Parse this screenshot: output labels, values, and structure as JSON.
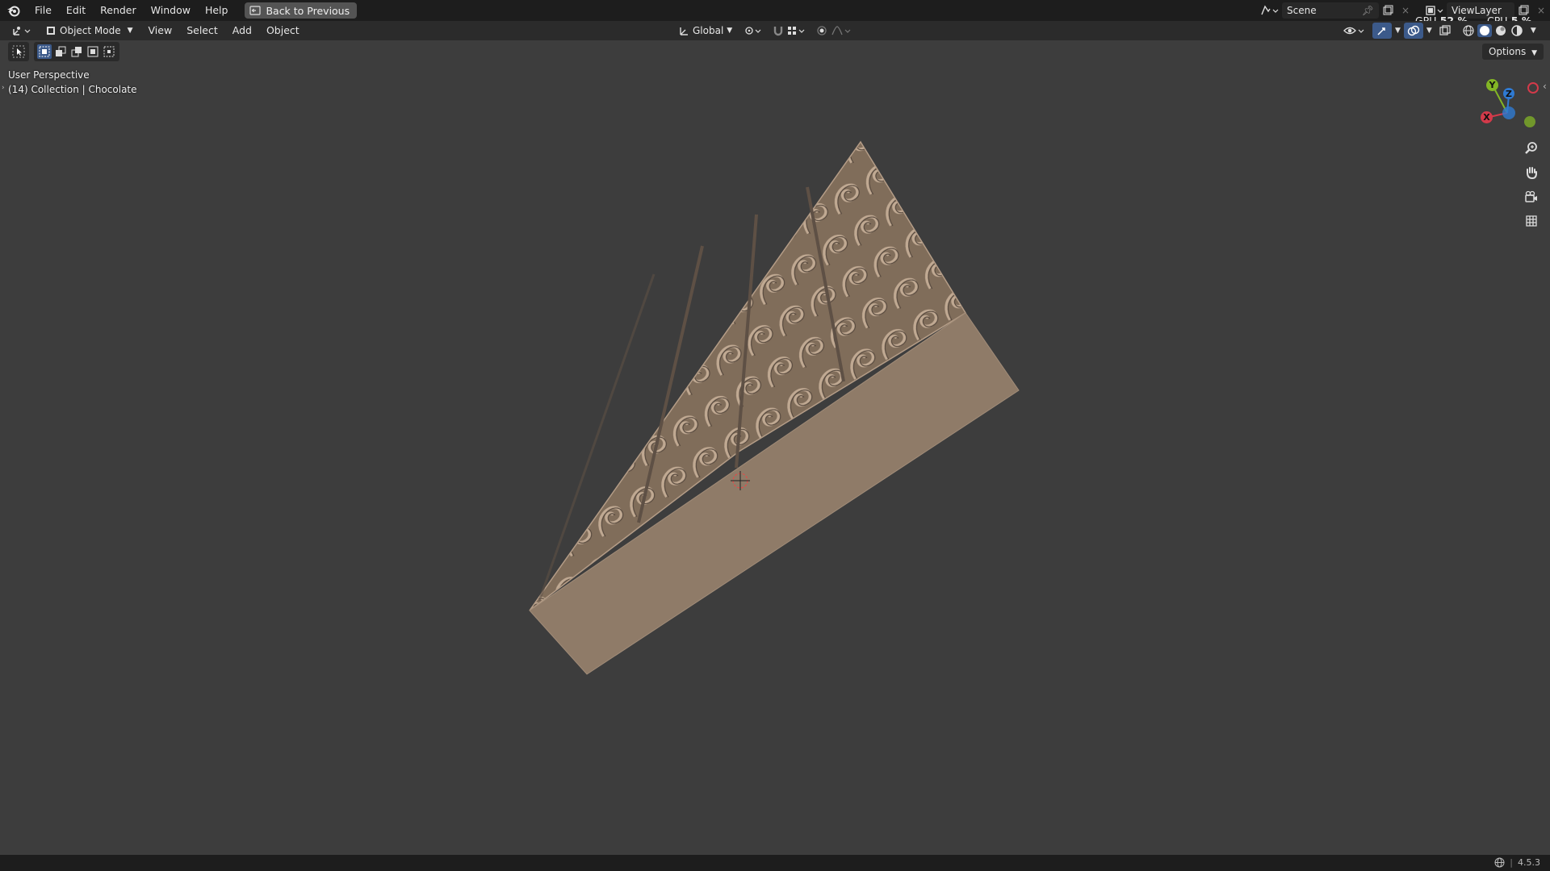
{
  "menubar": {
    "items": [
      "File",
      "Edit",
      "Render",
      "Window",
      "Help"
    ],
    "back_button": "Back to Previous"
  },
  "scene": {
    "name": "Scene"
  },
  "view_layer": {
    "name": "ViewLayer"
  },
  "stats": {
    "gpu_label": "GPU",
    "gpu_value": "52 %",
    "cpu_label": "CPU",
    "cpu_value": "5 %"
  },
  "header": {
    "mode": "Object Mode",
    "menus": [
      "View",
      "Select",
      "Add",
      "Object"
    ],
    "orientation": "Global",
    "options": "Options"
  },
  "viewport": {
    "perspective": "User Perspective",
    "collection": "(14) Collection | Chocolate"
  },
  "gizmo": {
    "x": "X",
    "y": "Y",
    "z": "Z"
  },
  "footer": {
    "version": "4.5.3"
  },
  "colors": {
    "background": "#3d3d3d",
    "chocolate": "#8f7b68",
    "axis_x": "#d33a4a",
    "axis_y": "#83b625",
    "axis_z": "#2f7ad2"
  }
}
